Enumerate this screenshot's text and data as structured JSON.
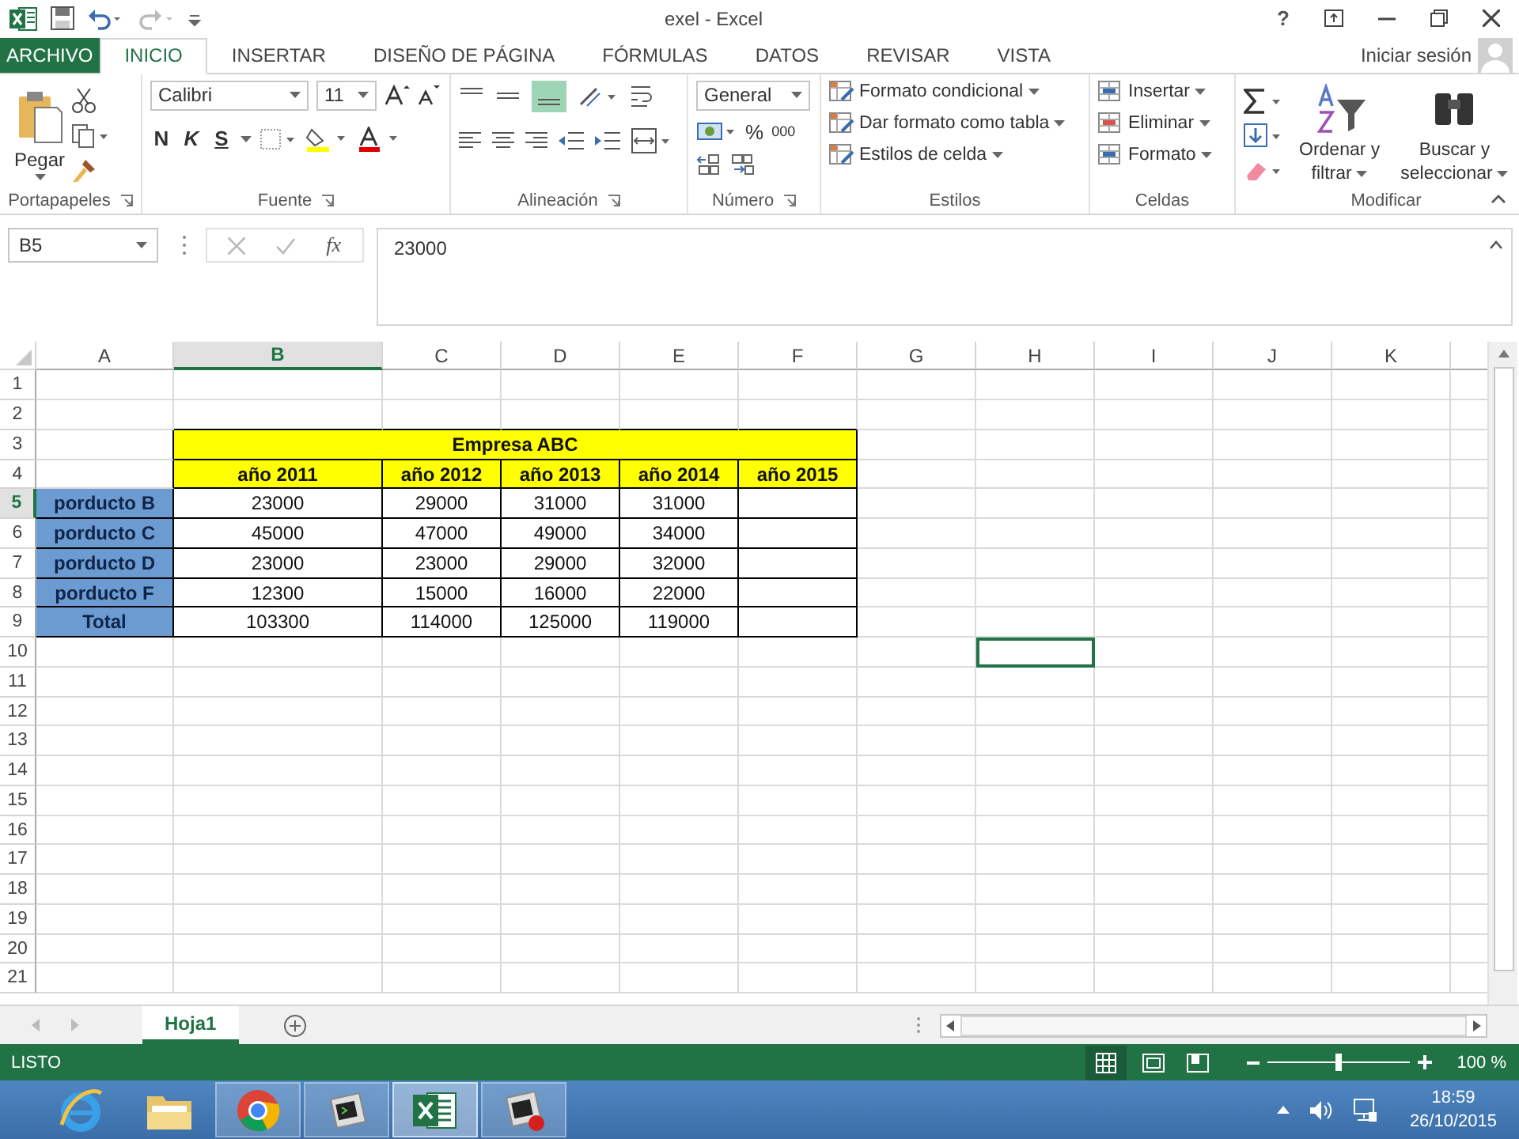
{
  "title_bar": {
    "title": "exel - Excel",
    "help": "?"
  },
  "ribbon_tabs": [
    {
      "label": "ARCHIVO",
      "kind": "file",
      "selected": false
    },
    {
      "label": "INICIO",
      "kind": "tab",
      "selected": true
    },
    {
      "label": "INSERTAR",
      "kind": "tab",
      "selected": false
    },
    {
      "label": "DISEÑO DE PÁGINA",
      "kind": "tab",
      "selected": false
    },
    {
      "label": "FÓRMULAS",
      "kind": "tab",
      "selected": false
    },
    {
      "label": "DATOS",
      "kind": "tab",
      "selected": false
    },
    {
      "label": "REVISAR",
      "kind": "tab",
      "selected": false
    },
    {
      "label": "VISTA",
      "kind": "tab",
      "selected": false
    }
  ],
  "account": {
    "label": "Iniciar sesión"
  },
  "ribbon": {
    "clipboard": {
      "label": "Portapapeles",
      "paste": "Pegar"
    },
    "font": {
      "label": "Fuente",
      "font_name": "Calibri",
      "font_size": "11",
      "bold": "N",
      "italic": "K",
      "underline": "S"
    },
    "alignment": {
      "label": "Alineación"
    },
    "number": {
      "label": "Número",
      "format": "General",
      "percent": "%",
      "thousands": "000"
    },
    "styles": {
      "label": "Estilos",
      "commands": [
        "Formato condicional",
        "Dar formato como tabla",
        "Estilos de celda"
      ]
    },
    "cells": {
      "label": "Celdas",
      "commands": [
        "Insertar",
        "Eliminar",
        "Formato"
      ]
    },
    "editing": {
      "label": "Modificar",
      "sort": [
        "Ordenar y",
        "filtrar"
      ],
      "find": [
        "Buscar y",
        "seleccionar"
      ]
    }
  },
  "formula_bar": {
    "name_box": "B5",
    "function_button": "fx",
    "value": "23000"
  },
  "sheet": {
    "columns": [
      {
        "label": "A",
        "selected": false,
        "outlined": false
      },
      {
        "label": "B",
        "selected": true,
        "outlined": false
      },
      {
        "label": "C",
        "selected": false,
        "outlined": false
      },
      {
        "label": "D",
        "selected": false,
        "outlined": false
      },
      {
        "label": "E",
        "selected": false,
        "outlined": false
      },
      {
        "label": "F",
        "selected": false,
        "outlined": false
      },
      {
        "label": "G",
        "selected": false,
        "outlined": false
      },
      {
        "label": "H",
        "selected": false,
        "outlined": true
      },
      {
        "label": "I",
        "selected": false,
        "outlined": false
      },
      {
        "label": "J",
        "selected": false,
        "outlined": false
      },
      {
        "label": "K",
        "selected": false,
        "outlined": false
      }
    ],
    "rows": [
      {
        "label": "1",
        "selected": false,
        "outlined": false
      },
      {
        "label": "2",
        "selected": false,
        "outlined": false
      },
      {
        "label": "3",
        "selected": false,
        "outlined": false
      },
      {
        "label": "4",
        "selected": false,
        "outlined": false
      },
      {
        "label": "5",
        "selected": true,
        "outlined": false
      },
      {
        "label": "6",
        "selected": false,
        "outlined": false
      },
      {
        "label": "7",
        "selected": false,
        "outlined": false
      },
      {
        "label": "8",
        "selected": false,
        "outlined": false
      },
      {
        "label": "9",
        "selected": false,
        "outlined": false
      },
      {
        "label": "10",
        "selected": false,
        "outlined": true
      },
      {
        "label": "11",
        "selected": false,
        "outlined": false
      },
      {
        "label": "12",
        "selected": false,
        "outlined": false
      },
      {
        "label": "13",
        "selected": false,
        "outlined": false
      },
      {
        "label": "14",
        "selected": false,
        "outlined": false
      },
      {
        "label": "15",
        "selected": false,
        "outlined": false
      },
      {
        "label": "16",
        "selected": false,
        "outlined": false
      },
      {
        "label": "17",
        "selected": false,
        "outlined": false
      },
      {
        "label": "18",
        "selected": false,
        "outlined": false
      },
      {
        "label": "19",
        "selected": false,
        "outlined": false
      },
      {
        "label": "20",
        "selected": false,
        "outlined": false
      },
      {
        "label": "21",
        "selected": false,
        "outlined": false
      }
    ],
    "table": {
      "title": "Empresa ABC",
      "headers": [
        "año 2011",
        "año 2012",
        "año 2013",
        "año 2014",
        "año 2015"
      ],
      "items": [
        {
          "label": "porducto B",
          "values": [
            "23000",
            "29000",
            "31000",
            "31000"
          ]
        },
        {
          "label": "porducto C",
          "values": [
            "45000",
            "47000",
            "49000",
            "34000"
          ]
        },
        {
          "label": "porducto D",
          "values": [
            "23000",
            "23000",
            "29000",
            "32000"
          ]
        },
        {
          "label": "porducto F",
          "values": [
            "12300",
            "15000",
            "16000",
            "22000"
          ]
        },
        {
          "label": "Total",
          "values": [
            "103300",
            "114000",
            "125000",
            "119000"
          ]
        }
      ]
    }
  },
  "sheet_tabs": [
    {
      "label": "Hoja1",
      "selected": true
    }
  ],
  "status_bar": {
    "mode": "LISTO",
    "zoom": "100 %",
    "zoom_slider": {
      "level": 0.5
    }
  },
  "taskbar": {
    "apps": [
      {
        "kind": "ie",
        "running": false,
        "selected": false
      },
      {
        "kind": "folder",
        "running": false,
        "selected": false
      },
      {
        "kind": "browser",
        "running": true,
        "selected": false
      },
      {
        "kind": "terminal",
        "running": true,
        "selected": false
      },
      {
        "kind": "excel",
        "running": true,
        "selected": true
      },
      {
        "kind": "recorder",
        "running": true,
        "selected": false
      }
    ],
    "time": "18:59",
    "date": "26/10/2015"
  }
}
